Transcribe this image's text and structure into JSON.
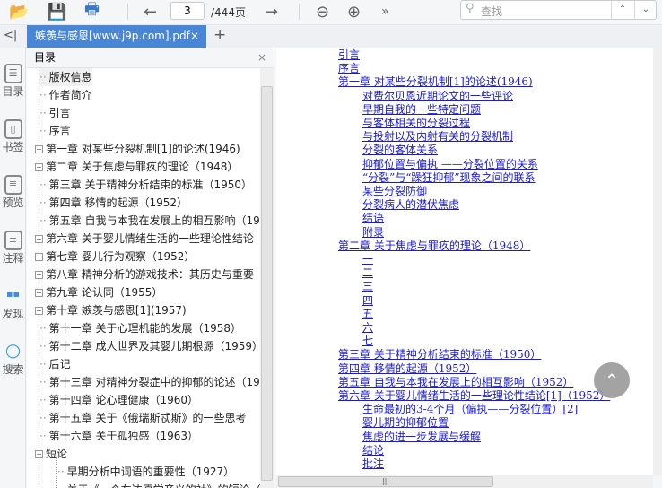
{
  "toolbar": {
    "page_current": "3",
    "page_total": "/444页",
    "search_placeholder": "查找"
  },
  "tab": {
    "title": "嫉羡与感恩[www.j9p.com].pdf",
    "close": "×",
    "add": "+",
    "collapse": "<|"
  },
  "left_strip": [
    {
      "label": "目录",
      "icon": "list-icon"
    },
    {
      "label": "书签",
      "icon": "bookmark-icon"
    },
    {
      "label": "预览",
      "icon": "preview-icon"
    },
    {
      "label": "注释",
      "icon": "note-icon"
    },
    {
      "label": "发现",
      "icon": "apps-icon"
    },
    {
      "label": "搜索",
      "icon": "search-icon"
    }
  ],
  "toc": {
    "title": "目录",
    "close": "×",
    "items": [
      {
        "label": "版权信息",
        "exp": ""
      },
      {
        "label": "作者简介",
        "exp": ""
      },
      {
        "label": "引言",
        "exp": ""
      },
      {
        "label": "序言",
        "exp": ""
      },
      {
        "label": "第一章 对某些分裂机制[1]的论述(1946)",
        "exp": "+"
      },
      {
        "label": "第二章 关于焦虑与罪疚的理论（1948）",
        "exp": "+"
      },
      {
        "label": "第三章 关于精神分析结束的标准（1950）",
        "exp": ""
      },
      {
        "label": "第四章 移情的起源（1952）",
        "exp": ""
      },
      {
        "label": "第五章 自我与本我在发展上的相互影响（19",
        "exp": ""
      },
      {
        "label": "第六章 关于婴儿情绪生活的一些理论性结论",
        "exp": "+"
      },
      {
        "label": "第七章 婴儿行为观察（1952）",
        "exp": "+"
      },
      {
        "label": "第八章 精神分析的游戏技术：其历史与重要",
        "exp": "+"
      },
      {
        "label": "第九章 论认同（1955）",
        "exp": "+"
      },
      {
        "label": "第十章 嫉羡与感恩[1](1957)",
        "exp": "+"
      },
      {
        "label": "第十一章 关于心理机能的发展（1958）",
        "exp": ""
      },
      {
        "label": "第十二章 成人世界及其婴儿期根源（1959）",
        "exp": ""
      },
      {
        "label": "后记",
        "exp": ""
      },
      {
        "label": "第十三章 对精神分裂症中的抑郁的论述（19",
        "exp": ""
      },
      {
        "label": "第十四章 论心理健康（1960）",
        "exp": ""
      },
      {
        "label": "第十五章 关于《俄瑞斯忒斯》的一些思考",
        "exp": ""
      },
      {
        "label": "第十六章 关于孤独感（1963）",
        "exp": ""
      },
      {
        "label": "短论",
        "exp": "−"
      }
    ],
    "subitems": [
      "早期分析中词语的重要性（1927）",
      "关于《一个左达原学音义的社》的短论（"
    ]
  },
  "content": [
    {
      "t": "引言",
      "l": 0
    },
    {
      "t": "序言",
      "l": 0
    },
    {
      "t": "第一章  对某些分裂机制[1]的论述(1946)",
      "l": 0
    },
    {
      "t": "对费尔贝恩近期论文的一些评论",
      "l": 1
    },
    {
      "t": "早期自我的一些特定问题",
      "l": 1
    },
    {
      "t": "与客体相关的分裂过程",
      "l": 1
    },
    {
      "t": "与投射以及内射有关的分裂机制",
      "l": 1
    },
    {
      "t": "分裂的客体关系",
      "l": 1
    },
    {
      "t": "抑郁位置与偏执 ——分裂位置的关系",
      "l": 1
    },
    {
      "t": "“分裂”与“躁狂抑郁”现象之间的联系",
      "l": 1
    },
    {
      "t": "某些分裂防御",
      "l": 1
    },
    {
      "t": "分裂病人的潜伏焦虑",
      "l": 1
    },
    {
      "t": "结语",
      "l": 1
    },
    {
      "t": "附录",
      "l": 1
    },
    {
      "t": "第二章  关于焦虑与罪疚的理论（1948）",
      "l": 0
    },
    {
      "t": "一",
      "l": 1
    },
    {
      "t": "二",
      "l": 1
    },
    {
      "t": "三",
      "l": 1
    },
    {
      "t": "四",
      "l": 1
    },
    {
      "t": "五",
      "l": 1
    },
    {
      "t": "六",
      "l": 1
    },
    {
      "t": "七",
      "l": 1
    },
    {
      "t": "第三章  关于精神分析结束的标准（1950）",
      "l": 0
    },
    {
      "t": "第四章  移情的起源（1952）",
      "l": 0
    },
    {
      "t": "第五章  自我与本我在发展上的相互影响（1952）",
      "l": 0
    },
    {
      "t": "第六章  关于婴儿情绪生活的一些理论性结论[1]（1952）",
      "l": 0
    },
    {
      "t": "生命最初的3-4个月（偏执——分裂位置）[2]",
      "l": 1
    },
    {
      "t": "婴儿期的抑郁位置",
      "l": 1
    },
    {
      "t": "焦虑的进一步发展与缓解",
      "l": 1
    },
    {
      "t": "结论",
      "l": 1
    },
    {
      "t": "批注",
      "l": 1
    }
  ],
  "colors": {
    "accent": "#4a86d6",
    "link": "#1a1ad8"
  }
}
